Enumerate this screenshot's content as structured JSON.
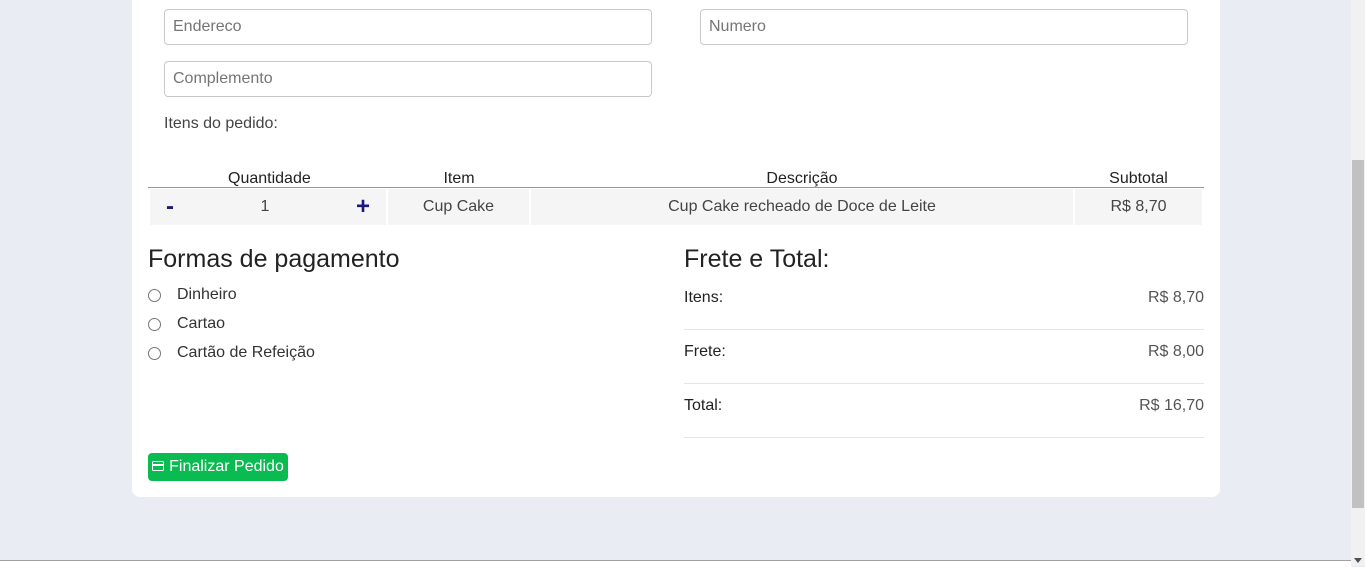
{
  "form": {
    "endereco_placeholder": "Endereco",
    "numero_placeholder": "Numero",
    "complemento_placeholder": "Complemento",
    "items_label": "Itens do pedido:"
  },
  "table": {
    "headers": [
      "Quantidade",
      "Item",
      "Descrição",
      "Subtotal"
    ],
    "rows": [
      {
        "minus": "-",
        "quantity": "1",
        "plus": "+",
        "item": "Cup Cake",
        "description": "Cup Cake recheado de Doce de Leite",
        "subtotal": "R$ 8,70"
      }
    ]
  },
  "payment": {
    "title": "Formas de pagamento",
    "options": [
      "Dinheiro",
      "Cartao",
      "Cartão de Refeição"
    ]
  },
  "summary": {
    "title": "Frete e Total:",
    "rows": [
      {
        "label": "Itens:",
        "value": "R$ 8,70"
      },
      {
        "label": "Frete:",
        "value": "R$ 8,00"
      },
      {
        "label": "Total:",
        "value": "R$ 16,70"
      }
    ]
  },
  "actions": {
    "submit_label": "Finalizar Pedido",
    "submit_icon": "credit-card-icon"
  },
  "colors": {
    "accent_green": "#0abb52",
    "qty_button": "#1a1a7e",
    "page_bg": "#e9edf3"
  }
}
